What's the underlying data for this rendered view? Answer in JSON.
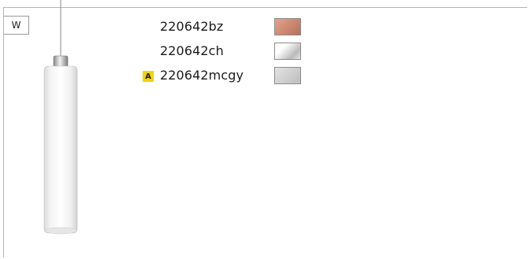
{
  "tag": {
    "label": "W"
  },
  "finishes": [
    {
      "code": "220642bz",
      "badge": "",
      "swatch_from": "#e3a48c",
      "swatch_to": "#b8705a"
    },
    {
      "code": "220642ch",
      "badge": "",
      "swatch_from": "#ffffff",
      "swatch_to": "#b9b9b9"
    },
    {
      "code": "220642mcgy",
      "badge": "A",
      "swatch_from": "#e3e3e3",
      "swatch_to": "#bdbdbd"
    }
  ]
}
